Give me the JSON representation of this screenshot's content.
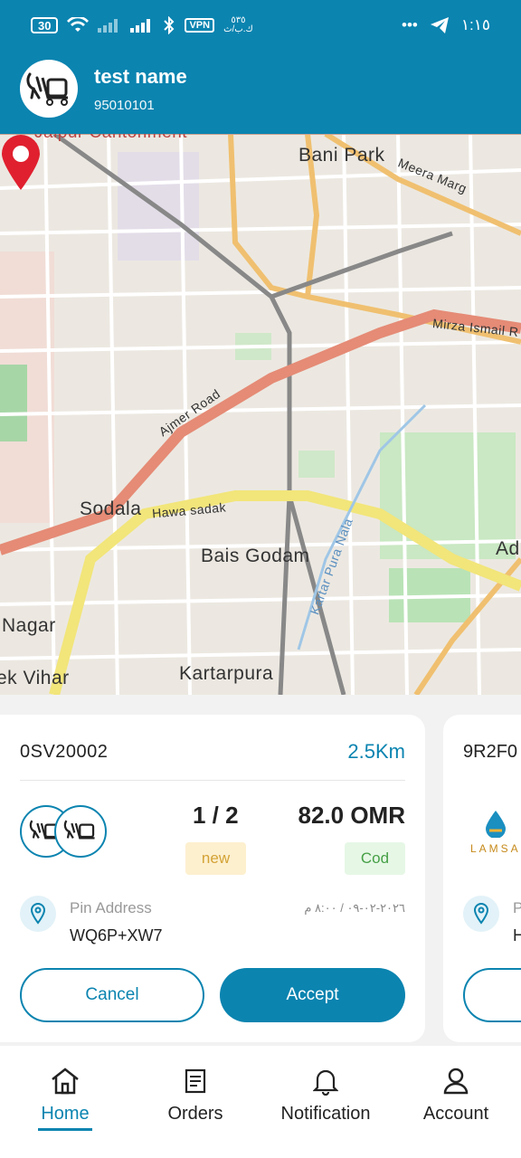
{
  "status_bar": {
    "battery": "30",
    "vpn": "VPN",
    "speed_top": "٥٣٥",
    "speed_bottom": "ك.ب/ث",
    "time": "١:١٥"
  },
  "user": {
    "name": "test name",
    "phone": "95010101"
  },
  "map": {
    "labels": {
      "jaipur": "Jaipur Cantonment",
      "bani_park": "Bani Park",
      "meera_marg": "Meera Marg",
      "mirza": "Mirza Ismail R",
      "ajmer": "Ajmer Road",
      "sodala": "Sodala",
      "hawa_sadak": "Hawa sadak",
      "bais_godam": "Bais Godam",
      "kartarpura_nala": "Kartar Pura Nala",
      "nagar": "Nagar",
      "vihar": "ek Vihar",
      "kartarpura": "Kartarpura",
      "ad": "Ad"
    }
  },
  "orders": [
    {
      "id": "0SV20002",
      "distance": "2.5Km",
      "count": "1 / 2",
      "price": "82.0 OMR",
      "status": "new",
      "payment": "Cod",
      "pin_label": "Pin Address",
      "pin_code": "WQ6P+XW7",
      "date": "٢٠٢٦-٠٢-٠٩ / ٨:٠٠ م",
      "cancel_label": "Cancel",
      "accept_label": "Accept"
    },
    {
      "id": "9R2F0",
      "brand": "LAMSA",
      "pin_label": "P",
      "pin_code": "H"
    }
  ],
  "nav": {
    "home": "Home",
    "orders": "Orders",
    "notification": "Notification",
    "account": "Account"
  },
  "colors": {
    "primary": "#0b84b0",
    "map_bg": "#efebe5",
    "pin_red": "#e0202f"
  }
}
